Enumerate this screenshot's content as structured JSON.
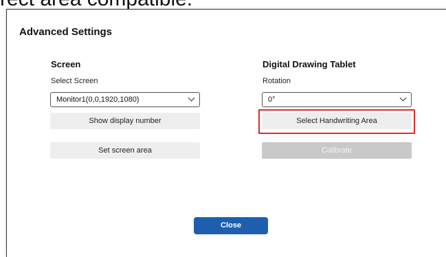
{
  "background_text": "rect area compatible.",
  "dialog": {
    "title": "Advanced Settings"
  },
  "screen": {
    "heading": "Screen",
    "select_label": "Select Screen",
    "select_value": "Monitor1(0,0,1920,1080)",
    "show_display_number": "Show display number",
    "set_screen_area": "Set screen area"
  },
  "tablet": {
    "heading": "Digital Drawing Tablet",
    "rotation_label": "Rotation",
    "rotation_value": "0°",
    "select_handwriting_area": "Select Handwriting Area",
    "calibrate": "Calibrate"
  },
  "footer": {
    "close_label": "Close"
  },
  "colors": {
    "accent": "#1d5fae",
    "highlight": "#e0292a",
    "button_bg": "#eeeeee",
    "disabled_bg": "#c9c9c9"
  }
}
